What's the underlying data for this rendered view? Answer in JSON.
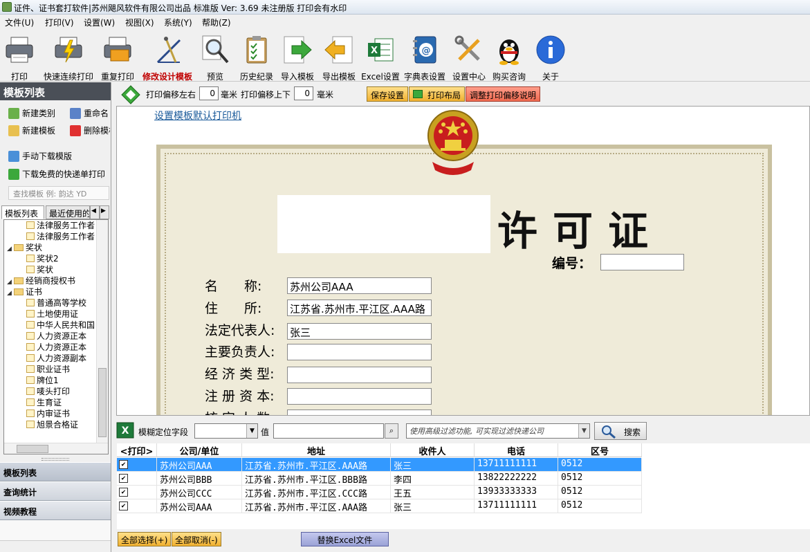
{
  "window": {
    "title": "证件、证书套打软件|苏州飓风软件有限公司出品 标准版  Ver: 3.69  未注册版 打印会有水印"
  },
  "menu": [
    "文件(U)",
    "打印(V)",
    "设置(W)",
    "视图(X)",
    "系统(Y)",
    "帮助(Z)"
  ],
  "toolbar": [
    {
      "label": "打印",
      "icon": "printer-icon"
    },
    {
      "label": "快速连续打印",
      "icon": "fast-print-icon"
    },
    {
      "label": "重复打印",
      "icon": "repeat-print-icon"
    },
    {
      "label": "修改设计模板",
      "icon": "design-compass-icon"
    },
    {
      "label": "预览",
      "icon": "magnifier-icon"
    },
    {
      "label": "历史纪录",
      "icon": "clipboard-icon"
    },
    {
      "label": "导入模板",
      "icon": "import-arrow-icon"
    },
    {
      "label": "导出模板",
      "icon": "export-arrow-icon"
    },
    {
      "label": "Excel设置",
      "icon": "excel-icon"
    },
    {
      "label": "字典表设置",
      "icon": "address-book-icon"
    },
    {
      "label": "设置中心",
      "icon": "tools-icon"
    },
    {
      "label": "购买咨询",
      "icon": "qq-penguin-icon"
    },
    {
      "label": "关于",
      "icon": "info-icon"
    }
  ],
  "left_panel": {
    "title": "模板列表",
    "actions": [
      "新建类别",
      "重命名",
      "新建模板",
      "删除模板",
      "手动下载模版",
      "下载免费的快递单打印"
    ],
    "search_placeholder": "查找模板 例: 韵达 YD",
    "tabs": [
      "模板列表",
      "最近使用的"
    ],
    "tree": [
      {
        "label": "法律服务工作者",
        "level": 2,
        "type": "file"
      },
      {
        "label": "法律服务工作者",
        "level": 2,
        "type": "file"
      },
      {
        "label": "奖状",
        "level": 1,
        "type": "folder"
      },
      {
        "label": "奖状2",
        "level": 2,
        "type": "file"
      },
      {
        "label": "奖状",
        "level": 2,
        "type": "file"
      },
      {
        "label": "经销商授权书",
        "level": 1,
        "type": "folder"
      },
      {
        "label": "证书",
        "level": 1,
        "type": "folder"
      },
      {
        "label": "普通高等学校",
        "level": 2,
        "type": "file"
      },
      {
        "label": "土地使用证",
        "level": 2,
        "type": "file"
      },
      {
        "label": "中华人民共和国",
        "level": 2,
        "type": "file"
      },
      {
        "label": "人力资源正本",
        "level": 2,
        "type": "file"
      },
      {
        "label": "人力资源正本",
        "level": 2,
        "type": "file"
      },
      {
        "label": "人力资源副本",
        "level": 2,
        "type": "file"
      },
      {
        "label": "职业证书",
        "level": 2,
        "type": "file"
      },
      {
        "label": "牌位1",
        "level": 2,
        "type": "file"
      },
      {
        "label": "唛头打印",
        "level": 2,
        "type": "file"
      },
      {
        "label": "生育证",
        "level": 2,
        "type": "file"
      },
      {
        "label": "内审证书",
        "level": 2,
        "type": "file"
      },
      {
        "label": "旭景合格证",
        "level": 2,
        "type": "file"
      }
    ],
    "nav": [
      "模板列表",
      "查询统计",
      "视频教程"
    ]
  },
  "offset_bar": {
    "lr_label": "打印偏移左右",
    "lr_value": "0",
    "unit": "毫米",
    "ud_label": "打印偏移上下",
    "ud_value": "0",
    "save_button": "保存设置",
    "layout_button": "打印布局",
    "help_button": "调整打印偏移说明"
  },
  "canvas": {
    "printer_link": "设置模板默认打印机",
    "cert_title": "许可证",
    "serial_label": "编号：",
    "fields": [
      {
        "label": "名　　称:",
        "value": "苏州公司AAA"
      },
      {
        "label": "住　　所:",
        "value": "江苏省.苏州市.平江区.AAA路"
      },
      {
        "label": "法定代表人:",
        "value": "张三"
      },
      {
        "label": "主要负责人:",
        "value": ""
      },
      {
        "label": "经 济 类 型:",
        "value": ""
      },
      {
        "label": "注 册 资 本:",
        "value": ""
      },
      {
        "label": "核 定 人 数",
        "value": ""
      }
    ]
  },
  "filter": {
    "field_label": "模糊定位字段",
    "field_value": "",
    "value_label": "值",
    "value": "",
    "hint": "使用高级过滤功能, 可实现过滤快递公司",
    "search_button": "搜索"
  },
  "grid": {
    "columns": [
      "<打印>",
      "公司/单位",
      "地址",
      "收件人",
      "电话",
      "区号"
    ],
    "rows": [
      {
        "checked": "✔",
        "company": "苏州公司AAA",
        "address": "江苏省.苏州市.平江区.AAA路",
        "recipient": "张三",
        "phone": "13711111111",
        "area": "0512"
      },
      {
        "checked": "✔",
        "company": "苏州公司BBB",
        "address": "江苏省.苏州市.平江区.BBB路",
        "recipient": "李四",
        "phone": "13822222222",
        "area": "0512"
      },
      {
        "checked": "✔",
        "company": "苏州公司CCC",
        "address": "江苏省.苏州市.平江区.CCC路",
        "recipient": "王五",
        "phone": "13933333333",
        "area": "0512"
      },
      {
        "checked": "✔",
        "company": "苏州公司AAA",
        "address": "江苏省.苏州市.平江区.AAA路",
        "recipient": "张三",
        "phone": "13711111111",
        "area": "0512"
      }
    ]
  },
  "bottom": {
    "select_all": "全部选择(+)",
    "deselect_all": "全部取消(-)",
    "replace_excel": "替换Excel文件"
  }
}
